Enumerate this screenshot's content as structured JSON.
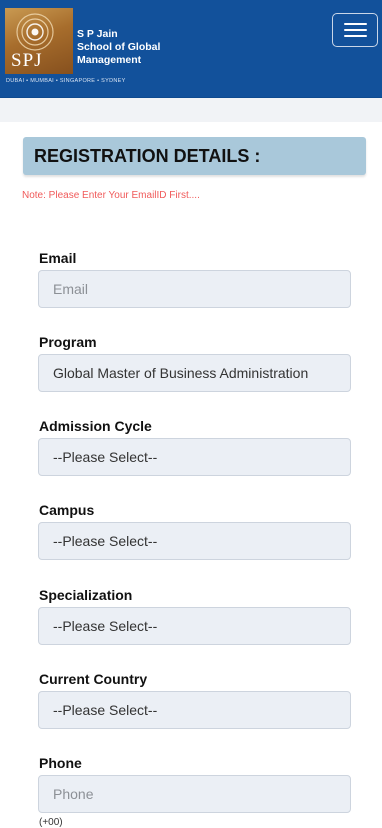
{
  "header": {
    "logo_monogram": "SPJ",
    "logo_line1": "S P Jain",
    "logo_line2": "School of Global",
    "logo_line3": "Management",
    "logo_cities": "DUBAI • MUMBAI • SINGAPORE • SYDNEY",
    "menu_icon": "hamburger-icon",
    "brand_color": "#12519b"
  },
  "section": {
    "title": "REGISTRATION DETAILS :",
    "title_bg": "#a9c8da",
    "note": "Note: Please Enter Your EmailID First....",
    "note_color": "#f05a5a"
  },
  "fields": {
    "email": {
      "label": "Email",
      "placeholder": "Email",
      "value": ""
    },
    "program": {
      "label": "Program",
      "value": "Global Master of Business Administration"
    },
    "admission_cycle": {
      "label": "Admission Cycle",
      "value": "--Please Select--"
    },
    "campus": {
      "label": "Campus",
      "value": "--Please Select--"
    },
    "specialization": {
      "label": "Specialization",
      "value": "--Please Select--"
    },
    "current_country": {
      "label": "Current Country",
      "value": "--Please Select--"
    },
    "phone": {
      "label": "Phone",
      "placeholder": "Phone",
      "value": ""
    }
  },
  "below_fold": {
    "partial_text": "(+00)"
  }
}
